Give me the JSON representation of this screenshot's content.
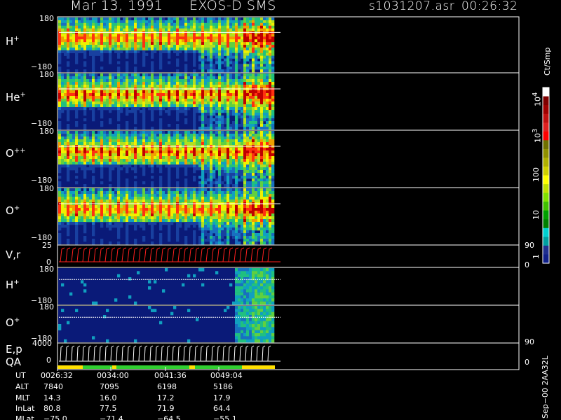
{
  "header": {
    "date": "Mar 13, 1991",
    "instrument": "EXOS-D SMS",
    "file": "s1031207.asr",
    "time": "00:26:32"
  },
  "colors": {
    "background": "#000000",
    "spectrogram_bg": "#0a1a78",
    "trace_red": "#ff2020",
    "qa_yellow": "#ffe000",
    "qa_green": "#30d030"
  },
  "panels": [
    {
      "id": "h-plus",
      "label": "H",
      "sup": "+",
      "ymax": "180",
      "ymin": "−180"
    },
    {
      "id": "he-plus",
      "label": "He",
      "sup": "+",
      "ymax": "180",
      "ymin": "−180"
    },
    {
      "id": "o-plus-plus",
      "label": "O",
      "sup": "++",
      "ymax": "180",
      "ymin": "−180"
    },
    {
      "id": "o-plus",
      "label": "O",
      "sup": "+",
      "ymax": "180",
      "ymin": "−180"
    },
    {
      "id": "v-r",
      "label": "V,r",
      "ymax": "25",
      "ymin": "0",
      "rmax": "90",
      "rmin": "0"
    },
    {
      "id": "h-plus-2",
      "label": "H",
      "sup": "+",
      "ymax": "180",
      "ymin": "−180"
    },
    {
      "id": "o-plus-2",
      "label": "O",
      "sup": "+",
      "ymax": "180",
      "ymin": "−180"
    },
    {
      "id": "e-p",
      "label": "E,p",
      "label2": "QA",
      "ymax": "4000",
      "ymin": "0",
      "rmax": "90",
      "rmin": "0"
    }
  ],
  "colorbar": {
    "unit": "Ct/Smp",
    "ticks": [
      "10",
      "4",
      "10",
      "3",
      "100",
      "10",
      "1"
    ],
    "colors": [
      "#ffffff",
      "#800000",
      "#a00000",
      "#c01010",
      "#e02020",
      "#ff0000",
      "#707000",
      "#909000",
      "#b0b000",
      "#d0d000",
      "#ffff00",
      "#c0e000",
      "#80e000",
      "#40c000",
      "#00a000",
      "#008000",
      "#00d0d0",
      "#00a0a0",
      "#203090",
      "#10208a"
    ]
  },
  "footer": {
    "row_labels": [
      "UT",
      "ALT",
      "MLT",
      "InLat",
      "MLat"
    ],
    "columns": [
      [
        "0026:32",
        "7840",
        "14.3",
        "80.8",
        "−75.0"
      ],
      [
        "0034:00",
        "7095",
        "16.0",
        "77.5",
        "−71.4"
      ],
      [
        "0041:36",
        "6198",
        "17.2",
        "71.9",
        "−64.5"
      ],
      [
        "0049:04",
        "5186",
        "17.9",
        "64.4",
        "−55.1"
      ]
    ],
    "stamp": "Sep−00 2AA32L"
  },
  "chart_data": {
    "type": "heatmap",
    "title": "",
    "x_ticks": [
      "0026:32",
      "0034:00",
      "0041:36",
      "0049:04"
    ],
    "series": [
      {
        "name": "H+",
        "pitch_angle_range": [
          -180,
          180
        ]
      },
      {
        "name": "He+",
        "pitch_angle_range": [
          -180,
          180
        ]
      },
      {
        "name": "O++",
        "pitch_angle_range": [
          -180,
          180
        ]
      },
      {
        "name": "O+",
        "pitch_angle_range": [
          -180,
          180
        ]
      },
      {
        "name": "V,r",
        "range": [
          0,
          25
        ],
        "right_range": [
          0,
          90
        ]
      },
      {
        "name": "H+",
        "pitch_angle_range": [
          -180,
          180
        ]
      },
      {
        "name": "O+",
        "pitch_angle_range": [
          -180,
          180
        ]
      },
      {
        "name": "E,p",
        "range": [
          0,
          4000
        ],
        "right_range": [
          0,
          90
        ]
      }
    ],
    "colorscale": {
      "unit": "Ct/Smp",
      "range": [
        1,
        10000
      ],
      "log": true
    }
  }
}
